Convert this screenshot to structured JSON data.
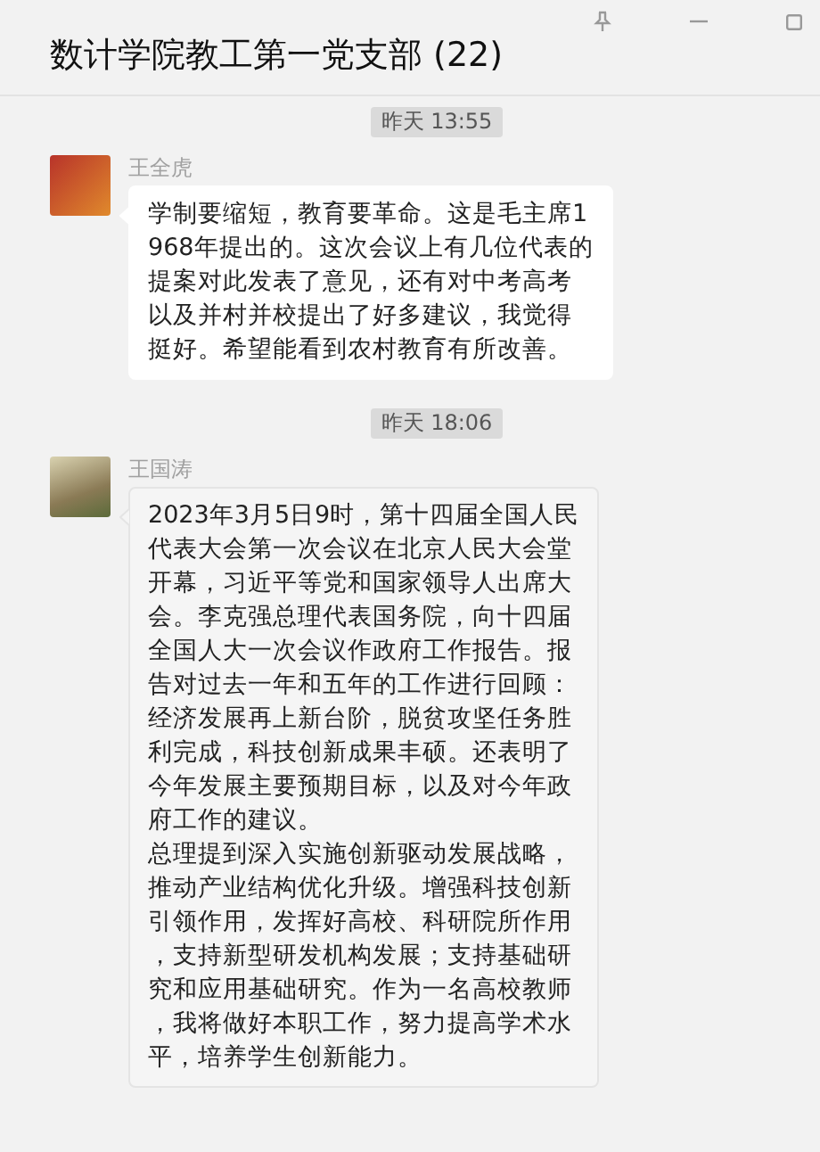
{
  "window": {
    "title": "数计学院教工第一党支部 (22)"
  },
  "messages": [
    {
      "time": "昨天 13:55",
      "sender": "王全虎",
      "highlighted": false,
      "lines": [
        "学制要缩短，教育要革命。这是毛主席1",
        "968年提出的。这次会议上有几位代表的",
        "提案对此发表了意见，还有对中考高考",
        "以及并村并校提出了好多建议，我觉得",
        "挺好。希望能看到农村教育有所改善。"
      ]
    },
    {
      "time": "昨天 18:06",
      "sender": "王国涛",
      "highlighted": true,
      "lines": [
        "2023年3月5日9时，第十四届全国人民",
        "代表大会第一次会议在北京人民大会堂",
        "开幕，习近平等党和国家领导人出席大",
        "会。李克强总理代表国务院，向十四届",
        "全国人大一次会议作政府工作报告。报",
        "告对过去一年和五年的工作进行回顾：",
        "经济发展再上新台阶，脱贫攻坚任务胜",
        "利完成，科技创新成果丰硕。还表明了",
        "今年发展主要预期目标，以及对今年政",
        "府工作的建议。",
        "总理提到深入实施创新驱动发展战略，",
        "推动产业结构优化升级。增强科技创新",
        "引领作用，发挥好高校、科研院所作用",
        "，支持新型研发机构发展；支持基础研",
        "究和应用基础研究。作为一名高校教师",
        "，我将做好本职工作，努力提高学术水",
        "平，培养学生创新能力。"
      ]
    }
  ]
}
